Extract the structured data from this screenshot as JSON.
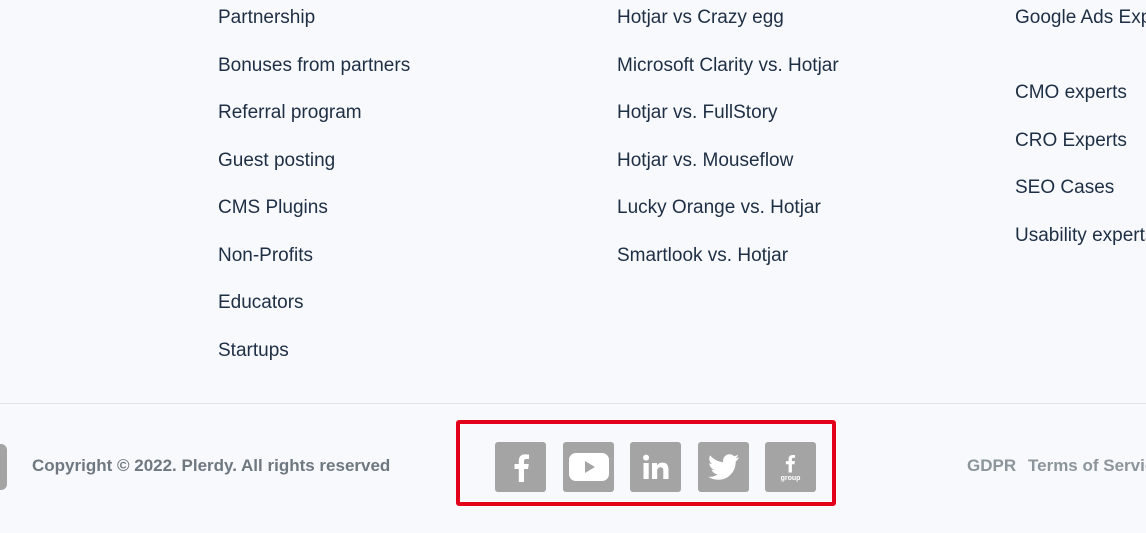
{
  "footer": {
    "columns": [
      {
        "links": [
          "Partnership",
          "Bonuses from partners",
          "Referral program",
          "Guest posting",
          "CMS Plugins",
          "Non-Profits",
          "Educators",
          "Startups"
        ]
      },
      {
        "links": [
          "Hotjar vs Crazy egg",
          "Microsoft Clarity vs. Hotjar",
          "Hotjar vs. FullStory",
          "Hotjar vs. Mouseflow",
          "Lucky Orange vs. Hotjar",
          "Smartlook vs. Hotjar"
        ]
      },
      {
        "links": [
          "Google Ads Experts",
          "CMO experts",
          "CRO Experts",
          "SEO Cases",
          "Usability experts"
        ]
      }
    ],
    "copyright": "Copyright © 2022. Plerdy. All rights reserved",
    "social": {
      "icons": [
        "facebook-icon",
        "youtube-icon",
        "linkedin-icon",
        "twitter-icon",
        "facebook-group-icon"
      ],
      "facebook_group_label": "group",
      "icon_color": "#a4a4a4",
      "highlight_color": "#e3001b"
    },
    "legal": {
      "gdpr": "GDPR",
      "terms": "Terms of Service"
    }
  },
  "colors": {
    "background": "#f8f9fc",
    "link_text": "#1e2e44",
    "muted_text": "#6f7880"
  }
}
